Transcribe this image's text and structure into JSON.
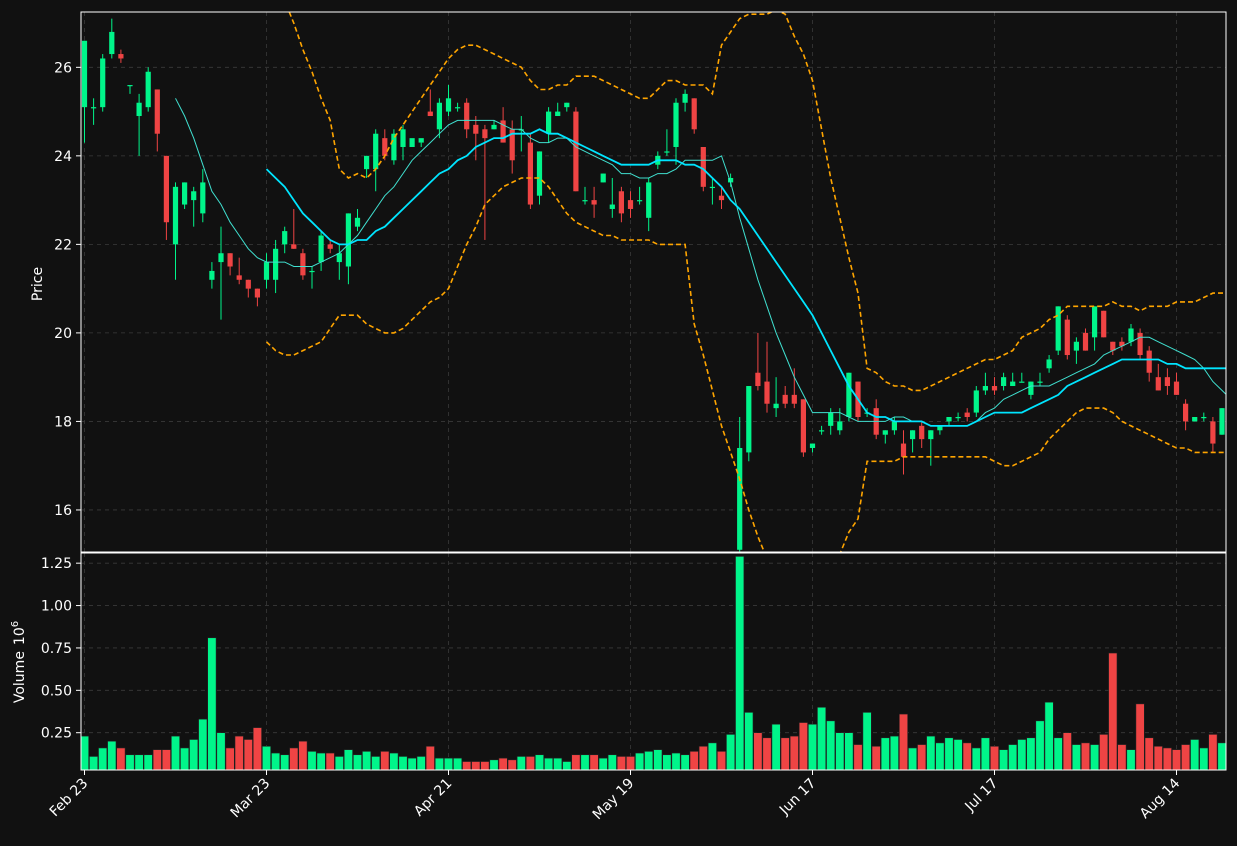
{
  "chart_data": {
    "type": "candlestick",
    "price_panel": {
      "ylabel": "Price",
      "ylim": [
        15.05,
        27.25
      ],
      "yticks": [
        16,
        18,
        20,
        22,
        24,
        26
      ]
    },
    "volume_panel": {
      "ylabel": "Volume",
      "ylabel_exponent": "10^6",
      "ylim": [
        0.03,
        1.31
      ],
      "yticks": [
        0.25,
        0.5,
        0.75,
        1.0,
        1.25
      ],
      "ytick_labels": [
        "0.25",
        "0.50",
        "0.75",
        "1.00",
        "1.25"
      ]
    },
    "xticks": [
      {
        "index": 0,
        "label": "Feb 23"
      },
      {
        "index": 20,
        "label": "Mar 23"
      },
      {
        "index": 40,
        "label": "Apr 21"
      },
      {
        "index": 60,
        "label": "May 19"
      },
      {
        "index": 80,
        "label": "Jun 17"
      },
      {
        "index": 100,
        "label": "Jul 17"
      },
      {
        "index": 120,
        "label": "Aug 14"
      }
    ],
    "grid": true,
    "colors": {
      "background": "#111111",
      "up": "#00f58a",
      "down": "#ef4444",
      "ma_slow": "#00e5ff",
      "ma_fast": "#40e0d0",
      "bollinger": "#ffa500",
      "grid": "#3a3a3a",
      "frame": "#ffffff"
    },
    "ohlc": [
      [
        25.1,
        26.6,
        24.3,
        26.6
      ],
      [
        25.1,
        25.3,
        24.7,
        25.1
      ],
      [
        25.1,
        26.3,
        25.0,
        26.2
      ],
      [
        26.3,
        27.1,
        26.2,
        26.8
      ],
      [
        26.3,
        26.4,
        26.1,
        26.2
      ],
      [
        25.6,
        25.6,
        25.4,
        25.6
      ],
      [
        24.9,
        25.4,
        24.0,
        25.2
      ],
      [
        25.1,
        26.0,
        25.0,
        25.9
      ],
      [
        25.5,
        25.5,
        24.1,
        24.5
      ],
      [
        24.0,
        24.0,
        22.1,
        22.5
      ],
      [
        22.0,
        23.4,
        21.2,
        23.3
      ],
      [
        22.9,
        23.4,
        22.8,
        23.4
      ],
      [
        23.0,
        23.3,
        22.4,
        23.2
      ],
      [
        22.7,
        23.7,
        22.5,
        23.4
      ],
      [
        21.2,
        21.6,
        21.0,
        21.4
      ],
      [
        21.6,
        22.4,
        20.3,
        21.8
      ],
      [
        21.8,
        21.8,
        21.3,
        21.5
      ],
      [
        21.3,
        21.7,
        21.1,
        21.2
      ],
      [
        21.2,
        21.2,
        20.8,
        21.0
      ],
      [
        21.0,
        21.0,
        20.6,
        20.8
      ],
      [
        21.2,
        21.8,
        21.0,
        21.6
      ],
      [
        21.2,
        22.1,
        20.9,
        21.9
      ],
      [
        22.0,
        22.4,
        21.8,
        22.3
      ],
      [
        22.0,
        22.8,
        21.9,
        21.9
      ],
      [
        21.8,
        21.9,
        21.2,
        21.3
      ],
      [
        21.4,
        21.5,
        21.0,
        21.4
      ],
      [
        21.6,
        22.3,
        21.4,
        22.2
      ],
      [
        22.0,
        22.1,
        21.8,
        21.9
      ],
      [
        21.6,
        22.0,
        21.2,
        21.8
      ],
      [
        21.5,
        22.7,
        21.1,
        22.7
      ],
      [
        22.4,
        22.8,
        22.3,
        22.6
      ],
      [
        23.7,
        24.0,
        23.5,
        24.0
      ],
      [
        23.7,
        24.6,
        23.2,
        24.5
      ],
      [
        24.4,
        24.6,
        23.9,
        24.0
      ],
      [
        23.9,
        24.6,
        23.8,
        24.5
      ],
      [
        24.2,
        24.7,
        23.9,
        24.6
      ],
      [
        24.2,
        24.3,
        24.2,
        24.4
      ],
      [
        24.3,
        24.3,
        24.2,
        24.4
      ],
      [
        25.0,
        25.5,
        24.9,
        24.9
      ],
      [
        24.6,
        25.3,
        24.4,
        25.2
      ],
      [
        25.0,
        25.6,
        24.9,
        25.3
      ],
      [
        25.1,
        25.2,
        25.0,
        25.1
      ],
      [
        25.2,
        25.3,
        24.4,
        24.6
      ],
      [
        24.7,
        24.9,
        23.9,
        24.5
      ],
      [
        24.6,
        24.7,
        22.1,
        24.4
      ],
      [
        24.6,
        24.8,
        24.6,
        24.7
      ],
      [
        24.8,
        25.1,
        24.3,
        24.3
      ],
      [
        24.6,
        24.8,
        23.6,
        23.9
      ],
      [
        24.6,
        24.9,
        24.1,
        24.6
      ],
      [
        24.3,
        24.5,
        22.8,
        22.9
      ],
      [
        23.1,
        24.1,
        22.9,
        24.1
      ],
      [
        24.5,
        25.1,
        24.3,
        25.0
      ],
      [
        24.9,
        25.2,
        24.9,
        25.0
      ],
      [
        25.1,
        25.2,
        25.0,
        25.2
      ],
      [
        25.0,
        25.1,
        23.2,
        23.2
      ],
      [
        23.0,
        23.3,
        22.9,
        23.0
      ],
      [
        23.0,
        23.3,
        22.6,
        22.9
      ],
      [
        23.4,
        23.6,
        23.4,
        23.6
      ],
      [
        22.8,
        23.5,
        22.6,
        22.9
      ],
      [
        23.2,
        23.3,
        22.5,
        22.7
      ],
      [
        23.0,
        23.2,
        22.6,
        22.8
      ],
      [
        23.0,
        23.3,
        22.9,
        23.0
      ],
      [
        22.6,
        23.5,
        22.3,
        23.4
      ],
      [
        23.8,
        24.1,
        23.7,
        24.0
      ],
      [
        24.1,
        24.6,
        24.0,
        24.1
      ],
      [
        24.2,
        25.3,
        23.8,
        25.2
      ],
      [
        25.2,
        25.5,
        25.0,
        25.4
      ],
      [
        25.3,
        25.3,
        24.5,
        24.6
      ],
      [
        24.2,
        24.2,
        23.2,
        23.3
      ],
      [
        23.3,
        23.5,
        22.9,
        23.3
      ],
      [
        23.1,
        23.3,
        22.8,
        23.0
      ],
      [
        23.4,
        23.6,
        23.3,
        23.5
      ],
      [
        15.1,
        18.1,
        15.0,
        17.4
      ],
      [
        17.3,
        18.8,
        17.1,
        18.8
      ],
      [
        19.1,
        20.0,
        18.7,
        18.8
      ],
      [
        18.9,
        19.8,
        18.2,
        18.4
      ],
      [
        18.3,
        19.0,
        18.1,
        18.4
      ],
      [
        18.6,
        18.8,
        18.3,
        18.4
      ],
      [
        18.6,
        19.2,
        18.3,
        18.4
      ],
      [
        18.5,
        18.5,
        17.2,
        17.3
      ],
      [
        17.4,
        17.5,
        17.3,
        17.5
      ],
      [
        17.8,
        17.9,
        17.7,
        17.8
      ],
      [
        17.9,
        18.3,
        17.7,
        18.2
      ],
      [
        17.8,
        18.3,
        17.7,
        18.0
      ],
      [
        18.1,
        19.1,
        18.0,
        19.1
      ],
      [
        18.9,
        18.9,
        18.0,
        18.1
      ],
      [
        18.2,
        18.3,
        18.1,
        18.2
      ],
      [
        18.3,
        18.5,
        17.6,
        17.7
      ],
      [
        17.7,
        17.8,
        17.5,
        17.8
      ],
      [
        17.8,
        18.1,
        17.7,
        18.0
      ],
      [
        17.5,
        17.8,
        16.8,
        17.2
      ],
      [
        17.6,
        17.8,
        17.3,
        17.8
      ],
      [
        17.9,
        18.0,
        17.4,
        17.6
      ],
      [
        17.6,
        17.8,
        17.0,
        17.8
      ],
      [
        17.8,
        17.9,
        17.7,
        17.9
      ],
      [
        18.0,
        18.1,
        17.9,
        18.1
      ],
      [
        18.1,
        18.2,
        18.0,
        18.1
      ],
      [
        18.2,
        18.3,
        18.0,
        18.1
      ],
      [
        18.2,
        18.8,
        18.1,
        18.7
      ],
      [
        18.7,
        19.1,
        18.6,
        18.8
      ],
      [
        18.8,
        19.0,
        18.6,
        18.7
      ],
      [
        18.8,
        19.1,
        18.7,
        19.0
      ],
      [
        18.8,
        19.1,
        18.8,
        18.9
      ],
      [
        18.9,
        19.1,
        18.9,
        18.9
      ],
      [
        18.6,
        18.9,
        18.5,
        18.9
      ],
      [
        18.9,
        19.1,
        18.8,
        18.9
      ],
      [
        19.2,
        19.5,
        19.1,
        19.4
      ],
      [
        19.6,
        20.6,
        19.5,
        20.6
      ],
      [
        20.3,
        20.4,
        19.4,
        19.5
      ],
      [
        19.6,
        19.9,
        19.3,
        19.8
      ],
      [
        20.0,
        20.1,
        19.6,
        19.6
      ],
      [
        19.9,
        20.6,
        19.6,
        20.6
      ],
      [
        20.5,
        20.5,
        19.9,
        19.9
      ],
      [
        19.8,
        19.8,
        19.5,
        19.6
      ],
      [
        19.8,
        19.9,
        19.6,
        19.7
      ],
      [
        19.8,
        20.2,
        19.7,
        20.1
      ],
      [
        20.0,
        20.1,
        19.4,
        19.5
      ],
      [
        19.6,
        19.7,
        18.9,
        19.1
      ],
      [
        19.0,
        19.3,
        18.7,
        18.7
      ],
      [
        19.0,
        19.2,
        18.6,
        18.8
      ],
      [
        18.9,
        19.1,
        18.6,
        18.6
      ],
      [
        18.4,
        18.5,
        17.8,
        18.0
      ],
      [
        18.0,
        18.1,
        18.0,
        18.1
      ],
      [
        18.1,
        18.2,
        18.0,
        18.1
      ],
      [
        18.0,
        18.1,
        17.3,
        17.5
      ],
      [
        17.7,
        18.3,
        17.7,
        18.3
      ]
    ],
    "volume": [
      0.23,
      0.11,
      0.16,
      0.2,
      0.16,
      0.12,
      0.12,
      0.12,
      0.15,
      0.15,
      0.23,
      0.16,
      0.21,
      0.33,
      0.81,
      0.25,
      0.16,
      0.23,
      0.21,
      0.28,
      0.17,
      0.13,
      0.12,
      0.16,
      0.2,
      0.14,
      0.13,
      0.13,
      0.11,
      0.15,
      0.12,
      0.14,
      0.11,
      0.14,
      0.13,
      0.11,
      0.1,
      0.11,
      0.17,
      0.1,
      0.1,
      0.1,
      0.08,
      0.08,
      0.08,
      0.09,
      0.1,
      0.09,
      0.11,
      0.11,
      0.12,
      0.1,
      0.1,
      0.08,
      0.12,
      0.12,
      0.12,
      0.1,
      0.12,
      0.11,
      0.11,
      0.13,
      0.14,
      0.15,
      0.12,
      0.13,
      0.12,
      0.14,
      0.17,
      0.19,
      0.14,
      0.24,
      1.29,
      0.37,
      0.25,
      0.22,
      0.3,
      0.22,
      0.23,
      0.31,
      0.3,
      0.4,
      0.32,
      0.25,
      0.25,
      0.18,
      0.37,
      0.17,
      0.22,
      0.23,
      0.36,
      0.16,
      0.18,
      0.23,
      0.19,
      0.22,
      0.21,
      0.19,
      0.16,
      0.22,
      0.17,
      0.15,
      0.18,
      0.21,
      0.22,
      0.32,
      0.43,
      0.22,
      0.25,
      0.18,
      0.19,
      0.18,
      0.24,
      0.72,
      0.18,
      0.15,
      0.42,
      0.22,
      0.17,
      0.16,
      0.15,
      0.18,
      0.21,
      0.16,
      0.24,
      0.19
    ],
    "ma_fast": [
      null,
      null,
      null,
      null,
      null,
      null,
      null,
      null,
      null,
      null,
      25.3,
      24.9,
      24.4,
      23.8,
      23.2,
      22.9,
      22.5,
      22.2,
      21.9,
      21.7,
      21.6,
      21.6,
      21.6,
      21.5,
      21.5,
      21.5,
      21.6,
      21.7,
      21.8,
      22.0,
      22.2,
      22.5,
      22.8,
      23.1,
      23.3,
      23.6,
      23.9,
      24.1,
      24.3,
      24.5,
      24.7,
      24.8,
      24.8,
      24.8,
      24.8,
      24.8,
      24.7,
      24.6,
      24.6,
      24.4,
      24.3,
      24.3,
      24.4,
      24.4,
      24.2,
      24.1,
      24.0,
      23.9,
      23.8,
      23.6,
      23.6,
      23.5,
      23.5,
      23.6,
      23.6,
      23.7,
      23.9,
      23.9,
      23.9,
      23.9,
      24.0,
      23.4,
      22.6,
      21.9,
      21.2,
      20.6,
      20.0,
      19.5,
      19.0,
      18.6,
      18.2,
      18.2,
      18.2,
      18.2,
      18.1,
      18.0,
      18.0,
      18.0,
      18.0,
      18.1,
      18.1,
      18.0,
      18.0,
      17.9,
      17.9,
      17.9,
      17.9,
      17.9,
      18.0,
      18.2,
      18.3,
      18.5,
      18.6,
      18.7,
      18.8,
      18.8,
      18.8,
      18.9,
      19.0,
      19.1,
      19.2,
      19.3,
      19.5,
      19.6,
      19.7,
      19.8,
      19.9,
      19.9,
      19.8,
      19.7,
      19.6,
      19.5,
      19.4,
      19.2,
      18.9,
      18.7,
      18.5
    ],
    "ma_slow": [
      null,
      null,
      null,
      null,
      null,
      null,
      null,
      null,
      null,
      null,
      null,
      null,
      null,
      null,
      null,
      null,
      null,
      null,
      null,
      null,
      23.7,
      23.5,
      23.3,
      23.0,
      22.7,
      22.5,
      22.3,
      22.1,
      22.0,
      22.0,
      22.1,
      22.1,
      22.3,
      22.4,
      22.6,
      22.8,
      23.0,
      23.2,
      23.4,
      23.6,
      23.7,
      23.9,
      24.0,
      24.2,
      24.3,
      24.4,
      24.4,
      24.5,
      24.5,
      24.5,
      24.6,
      24.5,
      24.5,
      24.4,
      24.3,
      24.2,
      24.1,
      24.0,
      23.9,
      23.8,
      23.8,
      23.8,
      23.8,
      23.9,
      23.9,
      23.9,
      23.8,
      23.8,
      23.7,
      23.5,
      23.3,
      23.0,
      22.8,
      22.5,
      22.2,
      21.9,
      21.6,
      21.3,
      21.0,
      20.7,
      20.4,
      20.0,
      19.6,
      19.2,
      18.8,
      18.5,
      18.2,
      18.1,
      18.1,
      18.0,
      18.0,
      18.0,
      18.0,
      17.9,
      17.9,
      17.9,
      17.9,
      17.9,
      18.0,
      18.1,
      18.2,
      18.2,
      18.2,
      18.2,
      18.3,
      18.4,
      18.5,
      18.6,
      18.8,
      18.9,
      19.0,
      19.1,
      19.2,
      19.3,
      19.4,
      19.4,
      19.4,
      19.4,
      19.4,
      19.3,
      19.3,
      19.2,
      19.2,
      19.2,
      19.2,
      19.2,
      19.2
    ],
    "bollinger_upper": [
      null,
      null,
      null,
      null,
      null,
      null,
      null,
      null,
      null,
      null,
      null,
      null,
      null,
      null,
      null,
      null,
      null,
      null,
      null,
      null,
      28.6,
      28.0,
      27.5,
      27.0,
      26.4,
      25.9,
      25.3,
      24.8,
      23.7,
      23.5,
      23.6,
      23.5,
      23.7,
      24.0,
      24.4,
      24.7,
      25.0,
      25.3,
      25.6,
      25.9,
      26.2,
      26.4,
      26.5,
      26.5,
      26.4,
      26.3,
      26.2,
      26.1,
      26.0,
      25.7,
      25.5,
      25.5,
      25.6,
      25.6,
      25.8,
      25.8,
      25.8,
      25.7,
      25.6,
      25.5,
      25.4,
      25.3,
      25.3,
      25.5,
      25.7,
      25.7,
      25.6,
      25.6,
      25.6,
      25.4,
      26.5,
      26.8,
      27.1,
      27.2,
      27.2,
      27.2,
      27.3,
      27.2,
      26.7,
      26.3,
      25.7,
      24.6,
      23.5,
      22.6,
      21.7,
      20.9,
      19.2,
      19.1,
      18.9,
      18.8,
      18.8,
      18.7,
      18.7,
      18.8,
      18.9,
      19.0,
      19.1,
      19.2,
      19.3,
      19.4,
      19.4,
      19.5,
      19.6,
      19.9,
      20.0,
      20.1,
      20.3,
      20.4,
      20.6,
      20.6,
      20.6,
      20.6,
      20.6,
      20.7,
      20.6,
      20.6,
      20.5,
      20.6,
      20.6,
      20.6,
      20.7,
      20.7,
      20.7,
      20.8,
      20.9,
      20.9,
      20.9
    ],
    "bollinger_lower": [
      null,
      null,
      null,
      null,
      null,
      null,
      null,
      null,
      null,
      null,
      null,
      null,
      null,
      null,
      null,
      null,
      null,
      null,
      null,
      null,
      19.8,
      19.6,
      19.5,
      19.5,
      19.6,
      19.7,
      19.8,
      20.1,
      20.4,
      20.4,
      20.4,
      20.2,
      20.1,
      20.0,
      20.0,
      20.1,
      20.3,
      20.5,
      20.7,
      20.8,
      21.0,
      21.5,
      22.0,
      22.4,
      22.9,
      23.1,
      23.3,
      23.4,
      23.5,
      23.5,
      23.5,
      23.3,
      23.0,
      22.7,
      22.5,
      22.4,
      22.3,
      22.2,
      22.2,
      22.1,
      22.1,
      22.1,
      22.1,
      22.0,
      22.0,
      22.0,
      22.0,
      20.2,
      19.5,
      18.7,
      17.9,
      17.3,
      16.7,
      16.0,
      15.4,
      14.9,
      14.5,
      14.1,
      13.9,
      13.7,
      13.7,
      14.2,
      14.5,
      15.0,
      15.5,
      15.8,
      17.1,
      17.1,
      17.1,
      17.1,
      17.2,
      17.2,
      17.2,
      17.2,
      17.2,
      17.2,
      17.2,
      17.2,
      17.2,
      17.2,
      17.1,
      17.0,
      17.0,
      17.1,
      17.2,
      17.3,
      17.6,
      17.8,
      18.0,
      18.2,
      18.3,
      18.3,
      18.3,
      18.2,
      18.0,
      17.9,
      17.8,
      17.7,
      17.6,
      17.5,
      17.4,
      17.4,
      17.3,
      17.3,
      17.3,
      17.3,
      17.3
    ]
  }
}
